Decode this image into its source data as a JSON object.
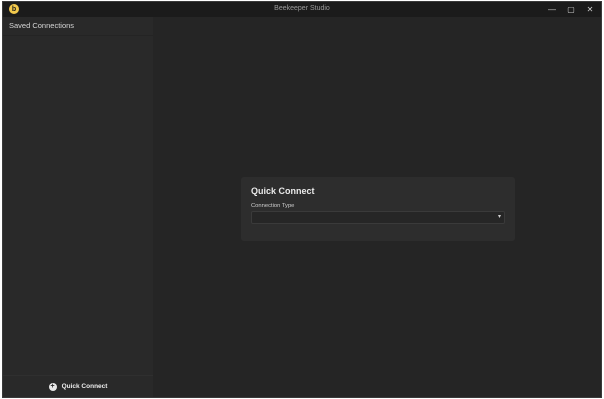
{
  "window": {
    "title": "Beekeeper Studio",
    "logo_letter": "b",
    "controls": {
      "minimize": "—",
      "maximize": "▢",
      "close": "✕"
    }
  },
  "sidebar": {
    "header": "Saved Connections",
    "footer_button": "Quick Connect",
    "footer_icon": "+"
  },
  "main": {
    "card": {
      "title": "Quick Connect",
      "connection_type_label": "Connection Type",
      "connection_type_value": ""
    }
  },
  "colors": {
    "accent": "#f2c94c",
    "background": "#252525",
    "sidebar": "#292929",
    "card": "#2d2d2d"
  },
  "icons": {
    "logo": "beekeeper-logo-icon",
    "add": "plus-circle-icon",
    "dropdown": "caret-down-icon"
  }
}
